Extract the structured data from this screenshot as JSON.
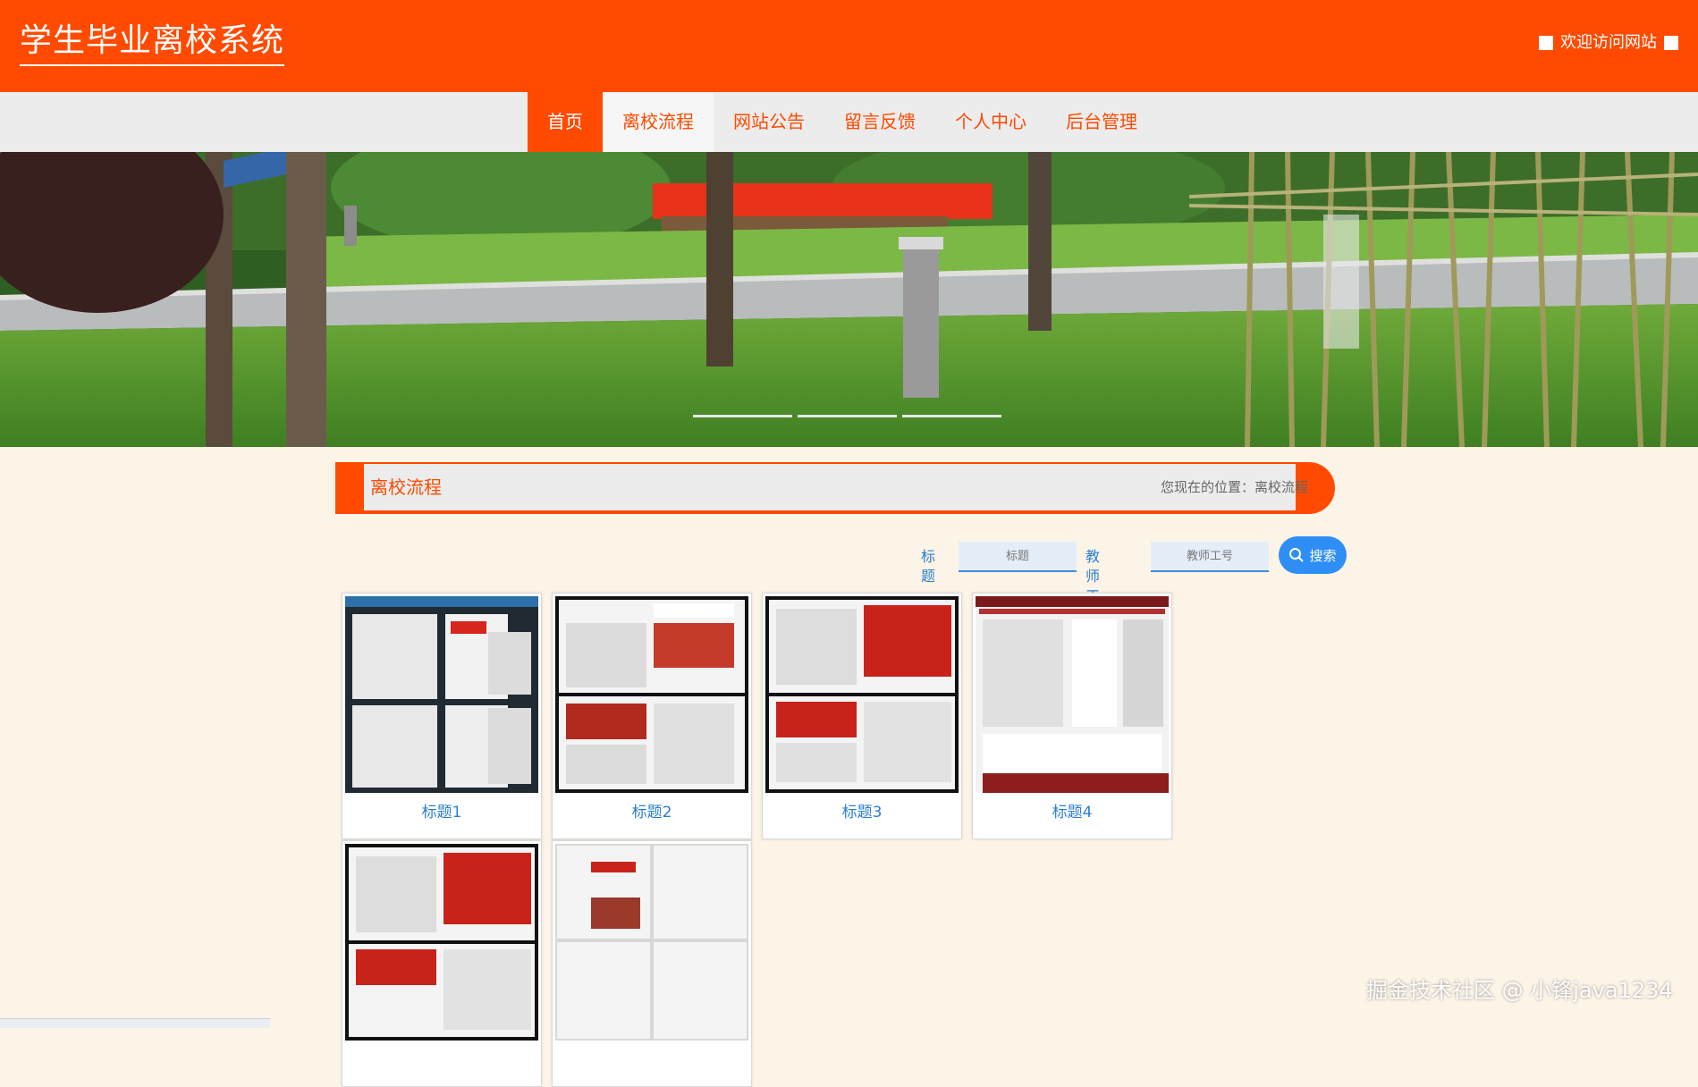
{
  "header": {
    "site_title": "学生毕业离校系统",
    "welcome": "欢迎访问网站"
  },
  "nav": {
    "items": [
      {
        "label": "首页",
        "state": "active"
      },
      {
        "label": "离校流程",
        "state": "hover"
      },
      {
        "label": "网站公告",
        "state": "normal"
      },
      {
        "label": "留言反馈",
        "state": "normal"
      },
      {
        "label": "个人中心",
        "state": "normal"
      },
      {
        "label": "后台管理",
        "state": "normal"
      }
    ]
  },
  "banner": {
    "slides": 3,
    "active_slide": 1
  },
  "section": {
    "title": "离校流程",
    "breadcrumb": "您现在的位置：离校流程"
  },
  "search": {
    "title_label": "标题",
    "title_placeholder": "标题",
    "teacher_label": "教师工号",
    "teacher_placeholder": "教师工号",
    "button_label": "搜索"
  },
  "cards": [
    {
      "caption": "标题1"
    },
    {
      "caption": "标题2"
    },
    {
      "caption": "标题3"
    },
    {
      "caption": "标题4"
    },
    {
      "caption": ""
    },
    {
      "caption": ""
    }
  ],
  "watermark": "掘金技术社区 @ 小锋java1234",
  "colors": {
    "brand": "#ff4a00",
    "link": "#2a7fd1",
    "button": "#2f8ef5",
    "page_bg": "#fdf4e8"
  }
}
